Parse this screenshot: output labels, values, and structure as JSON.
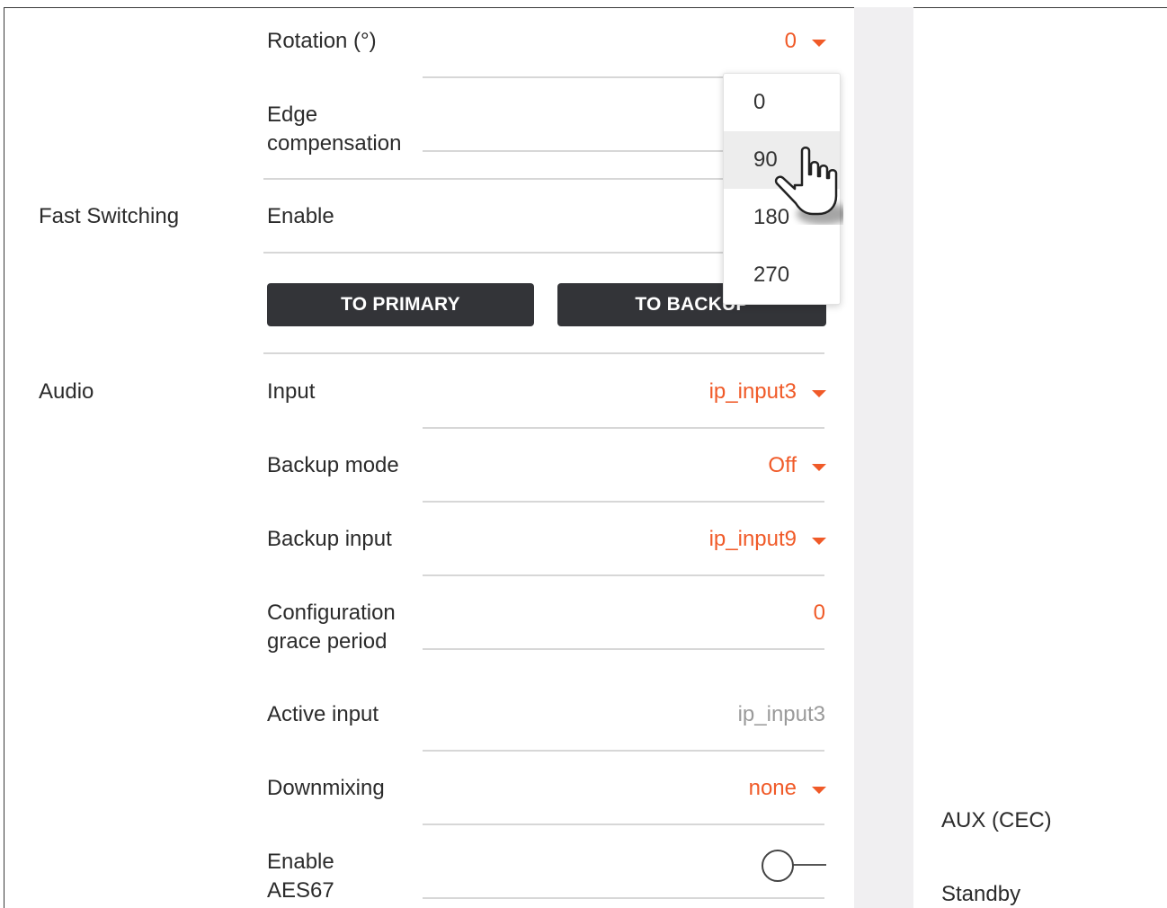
{
  "video": {
    "rotation": {
      "label": "Rotation (°)",
      "value": "0"
    },
    "edge_compensation": {
      "label": "Edge compensation"
    }
  },
  "fast_switching": {
    "section": "Fast Switching",
    "enable_label": "Enable",
    "to_primary": "TO PRIMARY",
    "to_backup": "TO BACKUP"
  },
  "audio": {
    "section": "Audio",
    "input": {
      "label": "Input",
      "value": "ip_input3"
    },
    "backup_mode": {
      "label": "Backup mode",
      "value": "Off"
    },
    "backup_input": {
      "label": "Backup input",
      "value": "ip_input9"
    },
    "grace_period": {
      "label": "Configuration grace period",
      "value": "0"
    },
    "active_input": {
      "label": "Active input",
      "value": "ip_input3"
    },
    "downmixing": {
      "label": "Downmixing",
      "value": "none"
    },
    "aes67": {
      "label": "Enable AES67",
      "enabled": false
    }
  },
  "right_panel": {
    "aux": "AUX (CEC)",
    "standby": "Standby"
  },
  "rotation_dropdown": {
    "options": [
      "0",
      "90",
      "180",
      "270"
    ],
    "hovered": "90"
  },
  "colors": {
    "accent": "#f05a28",
    "button_bg": "#333438",
    "muted": "#9a9a9a",
    "gray_column": "#f0eff1"
  },
  "icons": {
    "caret": "caret-down-icon",
    "cursor": "hand-pointer-icon"
  }
}
